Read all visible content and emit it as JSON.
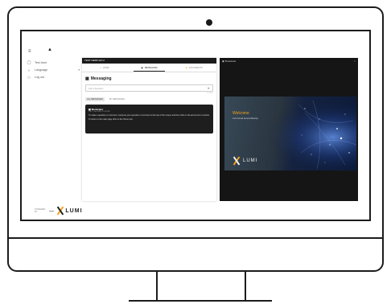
{
  "app": {
    "sidebar": {
      "items": [
        {
          "icon": "person-icon",
          "label": "Test User"
        },
        {
          "icon": "globe-icon",
          "label": "Language",
          "has_caret": true
        },
        {
          "icon": "logout-icon",
          "label": "Log out"
        }
      ],
      "powered_by": "POWERED BY",
      "brand": "LUMI"
    },
    "panel": {
      "header": "TEST DEMO EN 2",
      "tabs": [
        {
          "icon": "home-icon",
          "label": "HOME",
          "active": false
        },
        {
          "icon": "chat-icon",
          "label": "MESSAGING",
          "active": true
        },
        {
          "icon": "document-icon",
          "label": "DOCUMENTS",
          "active": false
        }
      ],
      "title": "Messaging",
      "ask_placeholder": "Ask a question",
      "char_counter": "0 / 500",
      "filters": [
        {
          "label": "ALL MESSAGES",
          "selected": true
        },
        {
          "label": "MY MESSAGES",
          "selected": false
        }
      ],
      "moderator": {
        "name": "Moderator",
        "time": "Thu, 1 Jan 2020, 12:00 PM",
        "lines": [
          "To make a question or comment, compose your question or comment at the top of the screen and then click on the arrow icon to submit.",
          "To return to the main page click on the Home icon."
        ]
      }
    },
    "broadcast": {
      "title": "Broadcast",
      "close_icon": "close-icon",
      "video": {
        "welcome": "Welcome",
        "subtitle": "Lumi Annual General Meeting",
        "brand": "LUMI"
      }
    }
  },
  "colors": {
    "accent": "#f3a21a",
    "dark_header": "#1b1b1b",
    "broadcast_bg": "#151515"
  }
}
